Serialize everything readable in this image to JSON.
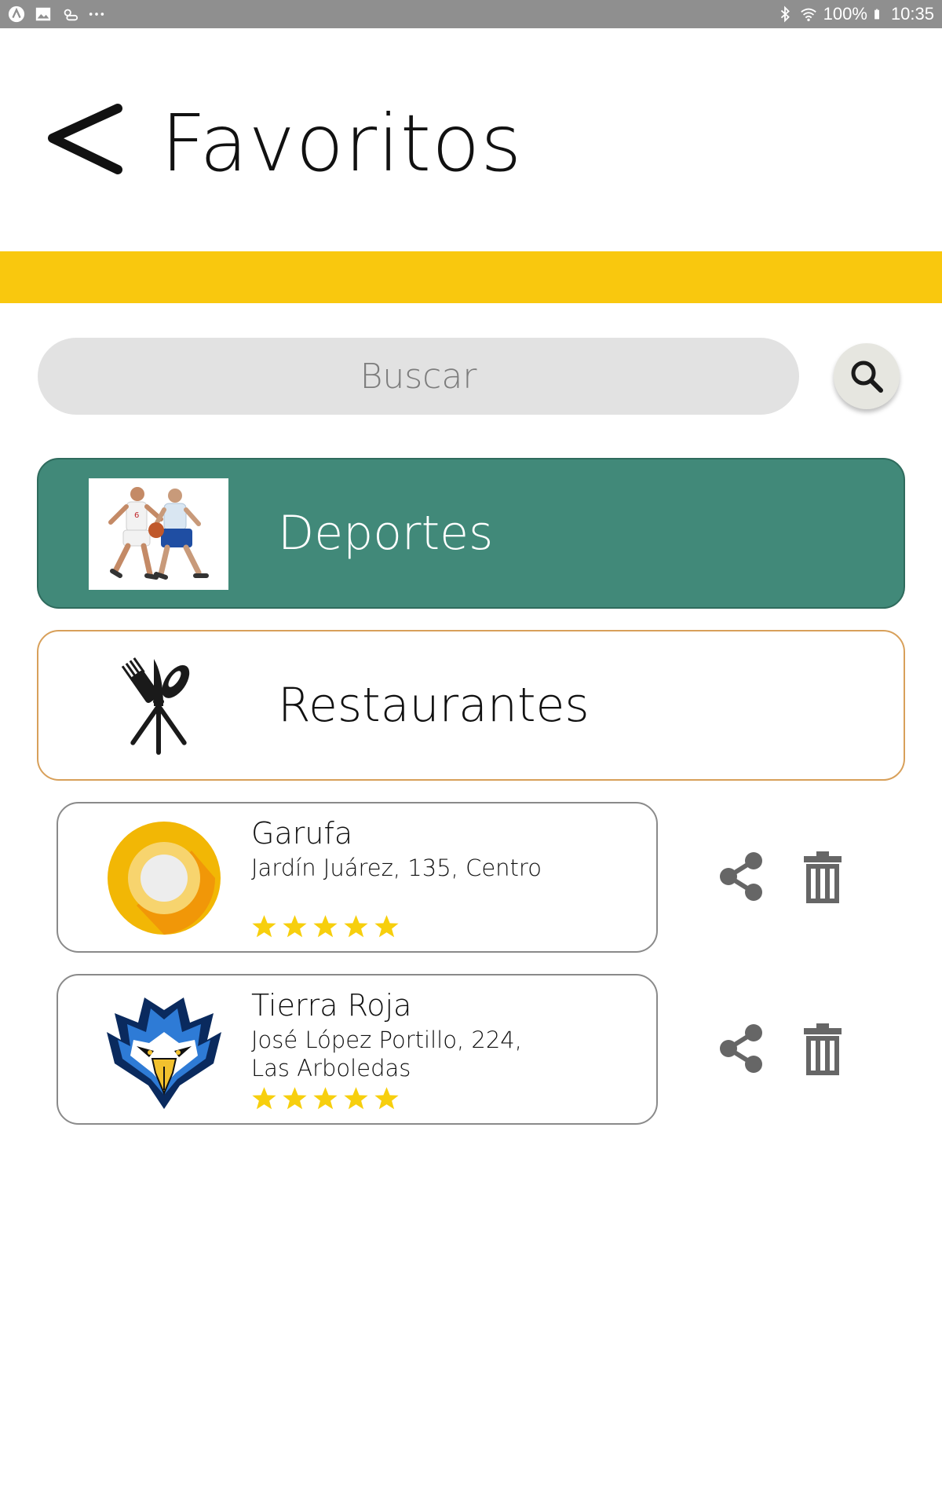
{
  "status_bar": {
    "battery": "100%",
    "time": "10:35",
    "icons": [
      "app-icon",
      "image-icon",
      "weather-icon",
      "more-dots-icon",
      "bluetooth-icon",
      "wifi-icon",
      "battery-icon"
    ]
  },
  "header": {
    "title": "Favoritos",
    "back_icon": "chevron-left-icon"
  },
  "accent_color": "#f9c80e",
  "search": {
    "placeholder": "Buscar",
    "button_icon": "search-icon"
  },
  "categories": [
    {
      "label": "Deportes",
      "icon": "basketball-players-image",
      "selected": true,
      "color": "#418979"
    },
    {
      "label": "Restaurantes",
      "icon": "cutlery-icon",
      "selected": false
    }
  ],
  "favorites": [
    {
      "name": "Garufa",
      "address": "Jardín Juárez, 135, Centro",
      "rating": 5,
      "logo": "android-oreo-logo"
    },
    {
      "name": "Tierra Roja",
      "address": "José López Portillo, 224, Las Arboledas",
      "rating": 5,
      "logo": "eagle-logo"
    }
  ],
  "actions": {
    "share_icon": "share-icon",
    "delete_icon": "trash-icon"
  }
}
